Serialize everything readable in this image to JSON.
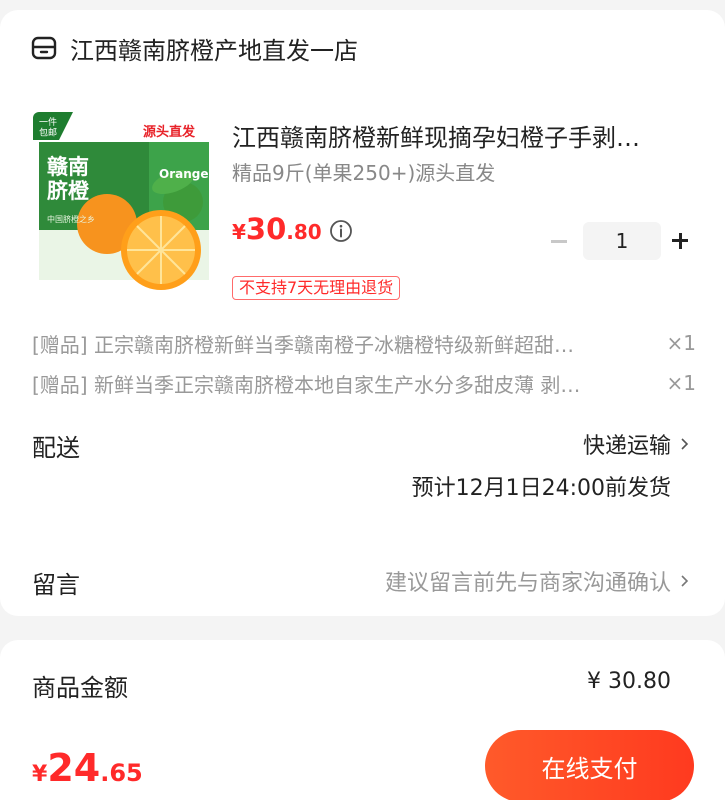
{
  "shop": {
    "name": "江西赣南脐橙产地直发一店",
    "icon": "store-icon"
  },
  "product": {
    "title": "江西赣南脐橙新鲜现摘孕妇橙子手剥…",
    "spec": "精品9斤(单果250+)源头直发",
    "price": {
      "currency": "¥",
      "integer": "30",
      "decimal": ".80"
    },
    "quantity": "1",
    "return_policy": "不支持7天无理由退货",
    "image": {
      "corner_tag": "一件\n包邮",
      "source_label": "源头直发",
      "brand_text": "赣南\n脐橙",
      "box_label": "Orange",
      "sub_text": "中国脐橙之乡"
    }
  },
  "gifts": [
    {
      "tag": "[赠品]",
      "text": "正宗赣南脐橙新鲜当季赣南橙子冰糖橙特级新鲜超甜…",
      "qty": "×1"
    },
    {
      "tag": "[赠品]",
      "text": "新鲜当季正宗赣南脐橙本地自家生产水分多甜皮薄 剥…",
      "qty": "×1"
    }
  ],
  "delivery": {
    "label": "配送",
    "method": "快递运输",
    "eta": "预计12月1日24:00前发货"
  },
  "message": {
    "label": "留言",
    "placeholder": "建议留言前先与商家沟通确认"
  },
  "summary": {
    "amount_label": "商品金额",
    "amount_value": "¥ 30.80"
  },
  "footer": {
    "total": {
      "currency": "¥",
      "integer": "24",
      "decimal": ".65"
    },
    "pay_label": "在线支付"
  },
  "colors": {
    "accent": "#ff2a2a",
    "pay_button": "#ff4422",
    "background": "#f4f4f4"
  }
}
